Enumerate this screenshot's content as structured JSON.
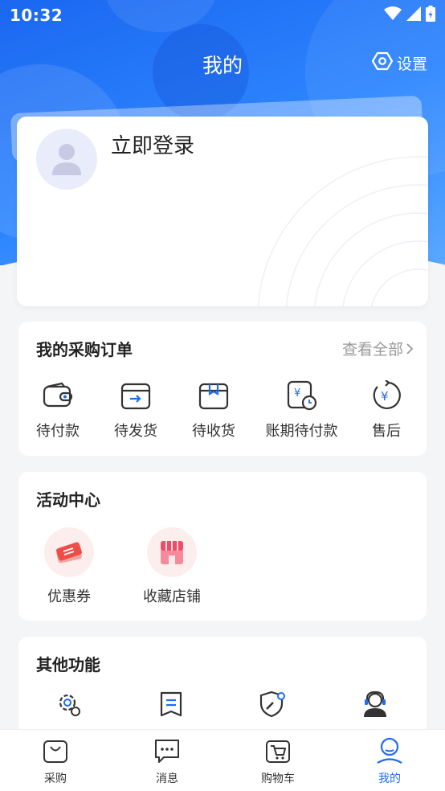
{
  "status_bar": {
    "time": "10:32"
  },
  "header": {
    "title": "我的",
    "settings_label": "设置"
  },
  "login": {
    "label": "立即登录"
  },
  "orders": {
    "title": "我的采购订单",
    "view_all": "查看全部",
    "items": [
      {
        "label": "待付款",
        "icon": "wallet-icon"
      },
      {
        "label": "待发货",
        "icon": "ship-box-icon"
      },
      {
        "label": "待收货",
        "icon": "receive-box-icon"
      },
      {
        "label": "账期待付款",
        "icon": "bill-clock-icon"
      },
      {
        "label": "售后",
        "icon": "refund-icon"
      }
    ]
  },
  "activity": {
    "title": "活动中心",
    "items": [
      {
        "label": "优惠券",
        "icon": "coupon-icon"
      },
      {
        "label": "收藏店铺",
        "icon": "store-icon"
      }
    ]
  },
  "other": {
    "title": "其他功能",
    "items": [
      {
        "icon": "gear-user-icon"
      },
      {
        "icon": "document-icon"
      },
      {
        "icon": "shield-tool-icon"
      },
      {
        "icon": "customer-service-icon"
      }
    ]
  },
  "bottom_nav": {
    "items": [
      {
        "label": "采购",
        "icon": "bag-icon"
      },
      {
        "label": "消息",
        "icon": "message-icon"
      },
      {
        "label": "购物车",
        "icon": "cart-icon"
      },
      {
        "label": "我的",
        "icon": "profile-icon"
      }
    ],
    "active_index": 3
  },
  "colors": {
    "brand": "#1f6cf0",
    "accent_red": "#f0504a"
  }
}
